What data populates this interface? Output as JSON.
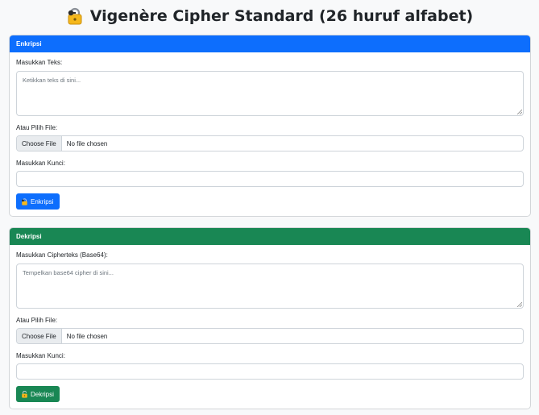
{
  "header": {
    "title": "Vigenère Cipher Standard (26 huruf alfabet)",
    "icon": "locked-with-key-icon"
  },
  "encrypt": {
    "title": "Enkripsi",
    "accent": "#0d6efd",
    "text_label": "Masukkan Teks:",
    "text_placeholder": "Ketikkan teks di sini...",
    "file_label": "Atau Pilih File:",
    "file_button": "Choose File",
    "file_status": "No file chosen",
    "key_label": "Masukkan Kunci:",
    "key_value": "",
    "submit_label": "Enkripsi"
  },
  "decrypt": {
    "title": "Dekripsi",
    "accent": "#198754",
    "text_label": "Masukkan Cipherteks (Base64):",
    "text_placeholder": "Tempelkan base64 cipher di sini...",
    "file_label": "Atau Pilih File:",
    "file_button": "Choose File",
    "file_status": "No file chosen",
    "key_label": "Masukkan Kunci:",
    "key_value": "",
    "submit_label": "Dekripsi"
  }
}
